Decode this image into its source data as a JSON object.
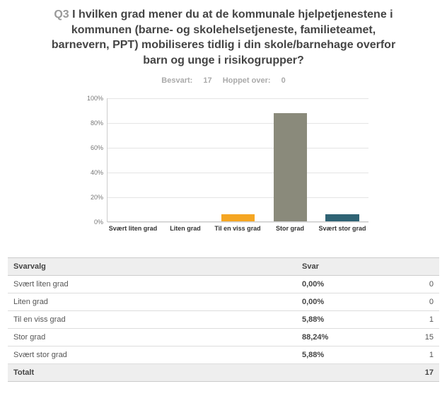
{
  "question": {
    "prefix": "Q3",
    "text": "I hvilken grad mener du at de kommunale hjelpetjenestene i kommunen (barne- og skolehelsetjeneste, familieteamet, barnevern, PPT) mobiliseres tidlig i din skole/barnehage overfor barn og unge i risikogrupper?"
  },
  "meta": {
    "answered_label": "Besvart:",
    "answered": 17,
    "skipped_label": "Hoppet over:",
    "skipped": 0
  },
  "table": {
    "col_option": "Svarvalg",
    "col_response": "Svar",
    "total_label": "Totalt",
    "total_count": 17
  },
  "colors": {
    "accent1": "#f5a623",
    "accent2": "#8a8a7b",
    "accent3": "#2f6374"
  },
  "chart_data": {
    "type": "bar",
    "title": "",
    "xlabel": "",
    "ylabel": "",
    "ylim": [
      0,
      100
    ],
    "yticks": [
      0,
      20,
      40,
      60,
      80,
      100
    ],
    "categories": [
      "Svært liten grad",
      "Liten grad",
      "Til en viss grad",
      "Stor grad",
      "Svært stor grad"
    ],
    "values": [
      0.0,
      0.0,
      5.88,
      88.24,
      5.88
    ],
    "counts": [
      0,
      0,
      1,
      15,
      1
    ],
    "value_labels": [
      "0,00%",
      "0,00%",
      "5,88%",
      "88,24%",
      "5,88%"
    ],
    "bar_colors": [
      "#8a8a7b",
      "#8a8a7b",
      "#f5a623",
      "#8a8a7b",
      "#2f6374"
    ]
  }
}
